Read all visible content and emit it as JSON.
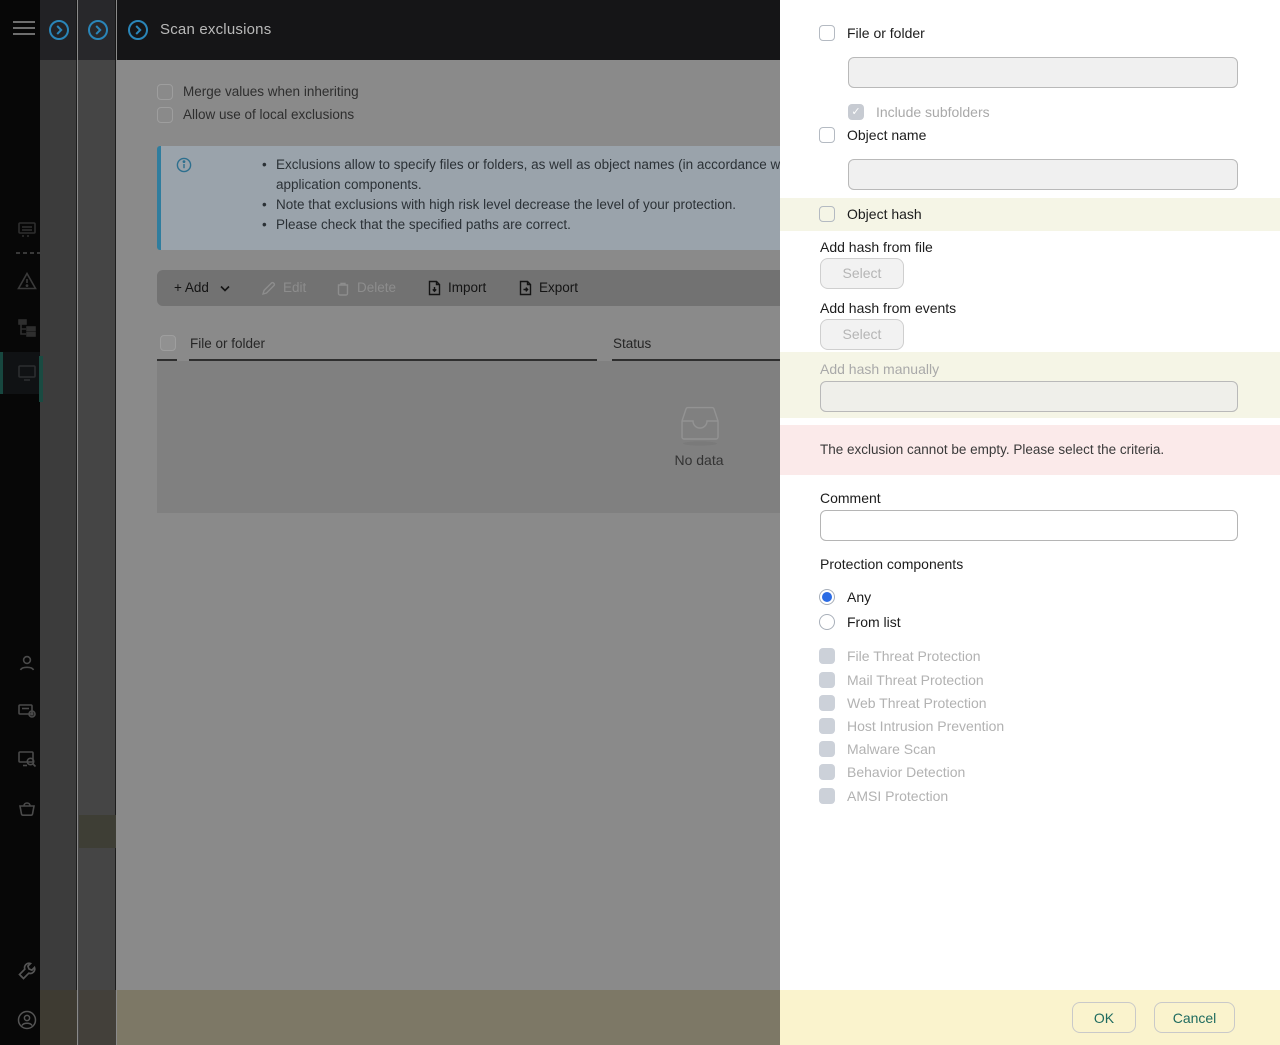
{
  "colors": {
    "accent_blue": "#2b6be4",
    "brand_teal": "#1f6b5f",
    "nav_teal_indicator": "#1a4b42",
    "info_blue": "#2f7d9e",
    "highlight_yellow": "#f5f5e6",
    "error_pink": "#fbeaea",
    "footer_yellow": "#faf3cd",
    "circle_icon_blue": "#2a85b8"
  },
  "header": {
    "title": "Scan exclusions"
  },
  "main": {
    "policy_checkboxes": [
      {
        "label": "Merge values when inheriting",
        "checked": false
      },
      {
        "label": "Allow use of local exclusions",
        "checked": false
      }
    ],
    "info_bullets": {
      "b1_line1": "Exclusions allow to specify files or folders, as well as object names (in accordance with Vir",
      "b1_line2": "application components.",
      "b2": "Note that exclusions with high risk level decrease the level of your protection.",
      "b3": "Please check that the specified paths are correct."
    },
    "toolbar": {
      "add_label": "+ Add",
      "edit_label": "Edit",
      "delete_label": "Delete",
      "import_label": "Import",
      "export_label": "Export"
    },
    "table": {
      "columns": [
        "File or folder",
        "Status"
      ],
      "empty_text": "No data"
    }
  },
  "drawer": {
    "criteria": {
      "file_or_folder": {
        "label": "File or folder",
        "checked": false,
        "value": ""
      },
      "include_subfolders": {
        "label": "Include subfolders",
        "checked": true,
        "disabled": true
      },
      "object_name": {
        "label": "Object name",
        "checked": false,
        "value": ""
      },
      "object_hash": {
        "label": "Object hash",
        "checked": false
      }
    },
    "hash": {
      "from_file_label": "Add hash from file",
      "from_events_label": "Add hash from events",
      "manual_label": "Add hash manually",
      "manual_value": "",
      "select_label": "Select"
    },
    "error_message": "The exclusion cannot be empty. Please select the criteria.",
    "comment": {
      "label": "Comment",
      "value": ""
    },
    "protection": {
      "title": "Protection components",
      "radio_any": "Any",
      "radio_from_list": "From list",
      "selected": "Any",
      "components": [
        "File Threat Protection",
        "Mail Threat Protection",
        "Web Threat Protection",
        "Host Intrusion Prevention",
        "Malware Scan",
        "Behavior Detection",
        "AMSI Protection"
      ]
    },
    "footer": {
      "ok_label": "OK",
      "cancel_label": "Cancel"
    }
  }
}
